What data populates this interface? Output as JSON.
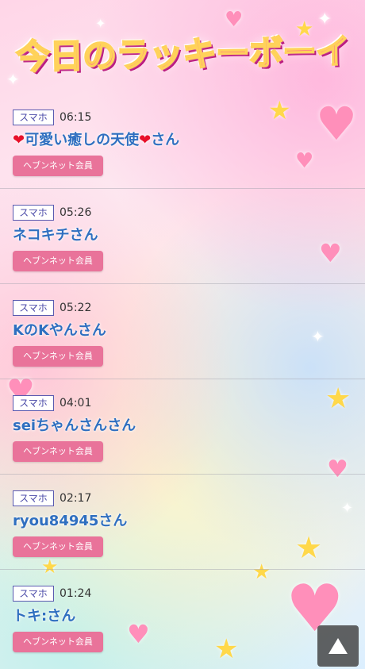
{
  "header": {
    "title": "今日のラッキーボーイ"
  },
  "entries": [
    {
      "device": "スマホ",
      "time": "06:15",
      "name_prefix": "❤",
      "name_main": "可愛い癒しの天使",
      "name_mid": "❤",
      "name_suffix": "さん",
      "member_label": "ヘブンネット会員"
    },
    {
      "device": "スマホ",
      "time": "05:26",
      "name_prefix": "",
      "name_main": "ネコキチさん",
      "name_mid": "",
      "name_suffix": "",
      "member_label": "ヘブンネット会員"
    },
    {
      "device": "スマホ",
      "time": "05:22",
      "name_prefix": "",
      "name_main": "KのKやんさん",
      "name_mid": "",
      "name_suffix": "",
      "member_label": "ヘブンネット会員"
    },
    {
      "device": "スマホ",
      "time": "04:01",
      "name_prefix": "",
      "name_main": "seiちゃんさんさん",
      "name_mid": "",
      "name_suffix": "",
      "member_label": "ヘブンネット会員"
    },
    {
      "device": "スマホ",
      "time": "02:17",
      "name_prefix": "",
      "name_main": "ryou84945さん",
      "name_mid": "",
      "name_suffix": "",
      "member_label": "ヘブンネット会員"
    },
    {
      "device": "スマホ",
      "time": "01:24",
      "name_prefix": "",
      "name_main": "トキ:さん",
      "name_mid": "",
      "name_suffix": "",
      "member_label": "ヘブンネット会員"
    }
  ],
  "icons": {
    "scroll_top": "triangle-up-icon"
  },
  "colors": {
    "name": "#2f6fc0",
    "member_button": "#e9739a",
    "badge_border": "#5a5ab0"
  }
}
